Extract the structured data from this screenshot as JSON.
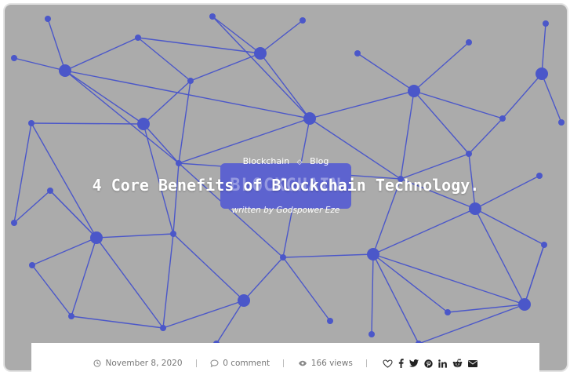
{
  "hero": {
    "categories": [
      "Blockchain",
      "Blog"
    ],
    "category_separator": "◇",
    "title": "4 Core Benefits of Blockchain Technology.",
    "byline": "written by Godspower Eze",
    "logo_word": "BLOCKCHAIN",
    "colors": {
      "background": "#ababab",
      "network": "#4b57c9",
      "logo_box": "#5d63cf"
    }
  },
  "meta": {
    "date": "November 8, 2020",
    "comments": "0 comment",
    "views": "166 views",
    "date_icon": "clock-icon",
    "comments_icon": "comment-icon",
    "views_icon": "eye-icon",
    "share_icons": [
      "heart-icon",
      "facebook-icon",
      "twitter-icon",
      "pinterest-icon",
      "linkedin-icon",
      "reddit-icon",
      "email-icon"
    ]
  }
}
